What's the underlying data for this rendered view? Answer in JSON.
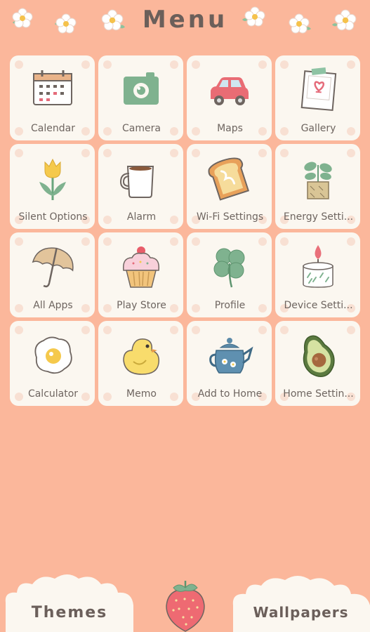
{
  "header": {
    "title": "Menu"
  },
  "tiles": [
    {
      "label": "Calendar",
      "icon": "calendar-icon"
    },
    {
      "label": "Camera",
      "icon": "camera-icon"
    },
    {
      "label": "Maps",
      "icon": "car-icon"
    },
    {
      "label": "Gallery",
      "icon": "photo-icon"
    },
    {
      "label": "Silent Options",
      "icon": "tulip-icon"
    },
    {
      "label": "Alarm",
      "icon": "mug-icon"
    },
    {
      "label": "Wi-Fi Settings",
      "icon": "toast-icon"
    },
    {
      "label": "Energy Setti...",
      "icon": "plant-icon"
    },
    {
      "label": "All Apps",
      "icon": "umbrella-icon"
    },
    {
      "label": "Play Store",
      "icon": "cupcake-icon"
    },
    {
      "label": "Profile",
      "icon": "clover-icon"
    },
    {
      "label": "Device Setti...",
      "icon": "candle-icon"
    },
    {
      "label": "Calculator",
      "icon": "egg-icon"
    },
    {
      "label": "Memo",
      "icon": "chick-icon"
    },
    {
      "label": "Add to Home",
      "icon": "teapot-icon"
    },
    {
      "label": "Home Settin...",
      "icon": "avocado-icon"
    }
  ],
  "bottom": {
    "themes_label": "Themes",
    "wallpapers_label": "Wallpapers",
    "center_icon": "strawberry-icon"
  },
  "colors": {
    "background": "#fbb79b",
    "tile": "#fbf7f0",
    "tile_dot": "#f8e0d3",
    "text": "#6e6560",
    "title": "#6b5f5a"
  }
}
